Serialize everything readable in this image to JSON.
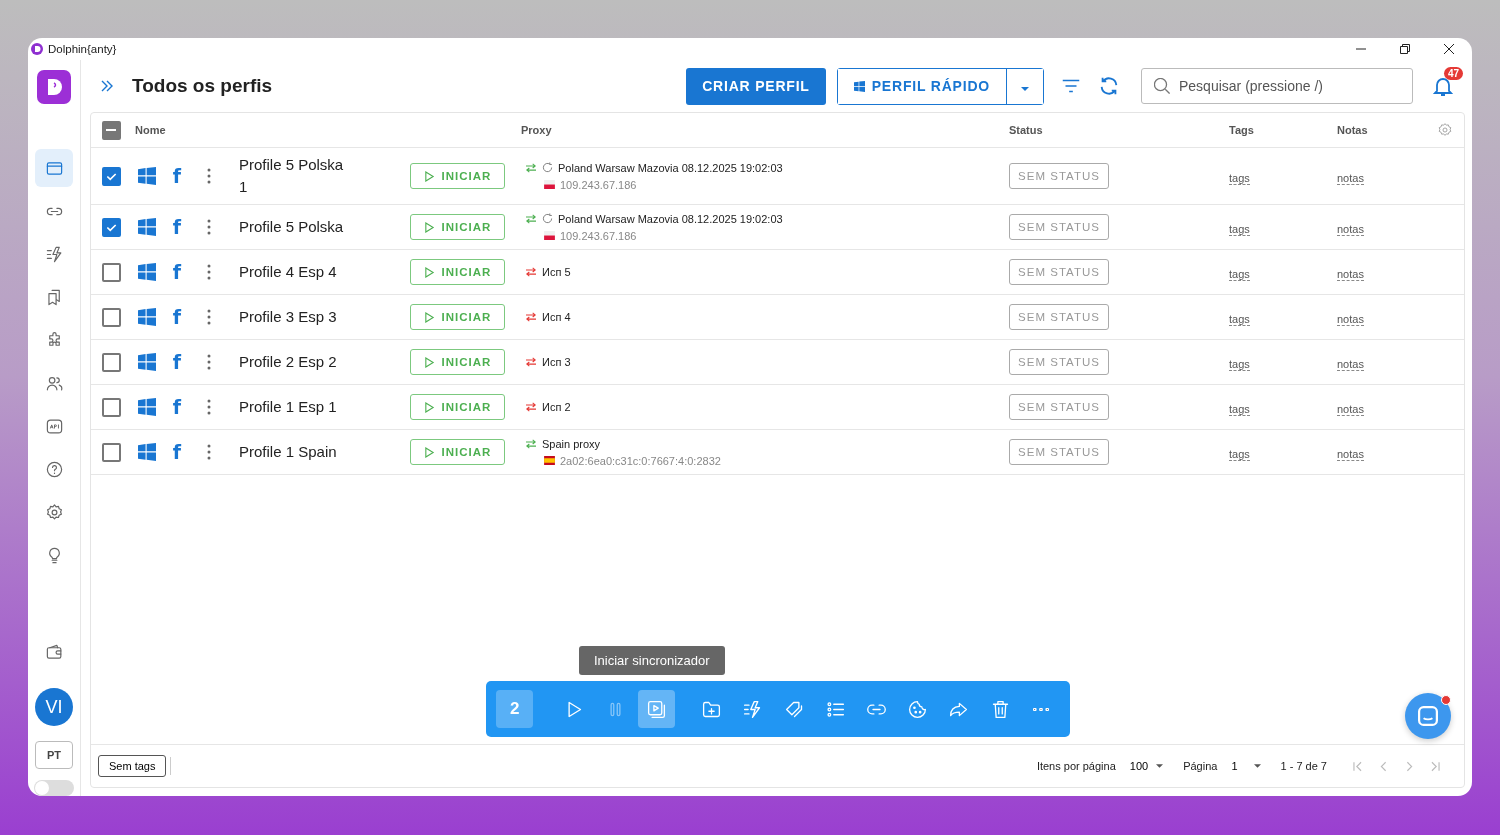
{
  "window": {
    "title": "Dolphin{anty}"
  },
  "sidebar": {
    "items": [
      {
        "kind": "profiles",
        "selected": true
      },
      {
        "kind": "proxies",
        "selected": false
      },
      {
        "kind": "automation",
        "selected": false
      },
      {
        "kind": "bookmarks",
        "selected": false
      },
      {
        "kind": "extensions",
        "selected": false
      },
      {
        "kind": "team",
        "selected": false
      },
      {
        "kind": "api",
        "selected": false
      },
      {
        "kind": "help",
        "selected": false
      },
      {
        "kind": "settings",
        "selected": false
      },
      {
        "kind": "ideas",
        "selected": false
      }
    ],
    "wallet": {
      "kind": "wallet"
    },
    "avatar": "VI",
    "language": "PT",
    "dark_mode": {
      "on": false
    }
  },
  "header": {
    "title": "Todos os perfis",
    "create_button": "CRIAR PERFIL",
    "quick_button": "PERFIL RÁPIDO",
    "search": {
      "placeholder": "Pesquisar (pressione /)"
    },
    "notifications": "47"
  },
  "table": {
    "select_all": {
      "indeterminate": true
    },
    "columns": [
      "Nome",
      "Proxy",
      "Status",
      "Tags",
      "Notas"
    ],
    "rows": [
      {
        "checked": true,
        "browser_mark": "f",
        "name": "Profile 5 Polska 1",
        "start": "INICIAR",
        "proxy": {
          "kind": "rotating",
          "working": true,
          "name": "Poland Warsaw Mazovia 08.12.2025 19:02:03",
          "flag": {
            "kind": "poland"
          },
          "ip": "109.243.67.186"
        },
        "status": "SEM STATUS",
        "tags": "tags",
        "notes": "notas"
      },
      {
        "checked": true,
        "browser_mark": "f",
        "name": "Profile 5 Polska",
        "start": "INICIAR",
        "proxy": {
          "kind": "rotating",
          "working": true,
          "name": "Poland Warsaw Mazovia 08.12.2025 19:02:03",
          "flag": {
            "kind": "poland"
          },
          "ip": "109.243.67.186"
        },
        "status": "SEM STATUS",
        "tags": "tags",
        "notes": "notas"
      },
      {
        "checked": false,
        "browser_mark": "f",
        "name": "Profile 4 Esp 4",
        "start": "INICIAR",
        "proxy": {
          "kind": "plain",
          "working": false,
          "name": "Исп 5"
        },
        "status": "SEM STATUS",
        "tags": "tags",
        "notes": "notas"
      },
      {
        "checked": false,
        "browser_mark": "f",
        "name": "Profile 3 Esp 3",
        "start": "INICIAR",
        "proxy": {
          "kind": "plain",
          "working": false,
          "name": "Исп 4"
        },
        "status": "SEM STATUS",
        "tags": "tags",
        "notes": "notas"
      },
      {
        "checked": false,
        "browser_mark": "f",
        "name": "Profile 2 Esp 2",
        "start": "INICIAR",
        "proxy": {
          "kind": "plain",
          "working": false,
          "name": "Исп 3"
        },
        "status": "SEM STATUS",
        "tags": "tags",
        "notes": "notas"
      },
      {
        "checked": false,
        "browser_mark": "f",
        "name": "Profile 1 Esp 1",
        "start": "INICIAR",
        "proxy": {
          "kind": "plain",
          "working": false,
          "name": "Исп 2"
        },
        "status": "SEM STATUS",
        "tags": "tags",
        "notes": "notas"
      },
      {
        "checked": false,
        "browser_mark": "f",
        "name": "Profile 1 Spain",
        "start": "INICIAR",
        "proxy": {
          "kind": "static",
          "working": true,
          "name": "Spain proxy",
          "flag": {
            "kind": "spain"
          },
          "ip": "2a02:6ea0:c31c:0:7667:4:0:2832"
        },
        "status": "SEM STATUS",
        "tags": "tags",
        "notes": "notas"
      }
    ]
  },
  "bulk_bar": {
    "count": "2",
    "tooltip": "Iniciar sincronizador",
    "actions": [
      {
        "kind": "play",
        "active": false,
        "disabled": false
      },
      {
        "kind": "pause",
        "active": false,
        "disabled": true
      },
      {
        "kind": "sync",
        "active": true,
        "disabled": false
      },
      {
        "kind": "folder",
        "active": false,
        "disabled": false
      },
      {
        "kind": "automation",
        "active": false,
        "disabled": false
      },
      {
        "kind": "tag",
        "active": false,
        "disabled": false
      },
      {
        "kind": "list",
        "active": false,
        "disabled": false
      },
      {
        "kind": "link",
        "active": false,
        "disabled": false
      },
      {
        "kind": "cookie",
        "active": false,
        "disabled": false
      },
      {
        "kind": "share",
        "active": false,
        "disabled": false
      },
      {
        "kind": "delete",
        "active": false,
        "disabled": false
      },
      {
        "kind": "more",
        "active": false,
        "disabled": false
      }
    ]
  },
  "chat": {
    "unread": true
  },
  "footer": {
    "tags_button": "Sem tags",
    "per_page_label": "Itens por página",
    "per_page": "100",
    "page_label": "Página",
    "page": "1",
    "range": "1 - 7 de 7",
    "nav": [
      {
        "kind": "first",
        "disabled": true
      },
      {
        "kind": "prev",
        "disabled": true
      },
      {
        "kind": "next",
        "disabled": true
      },
      {
        "kind": "last",
        "disabled": true
      }
    ]
  }
}
